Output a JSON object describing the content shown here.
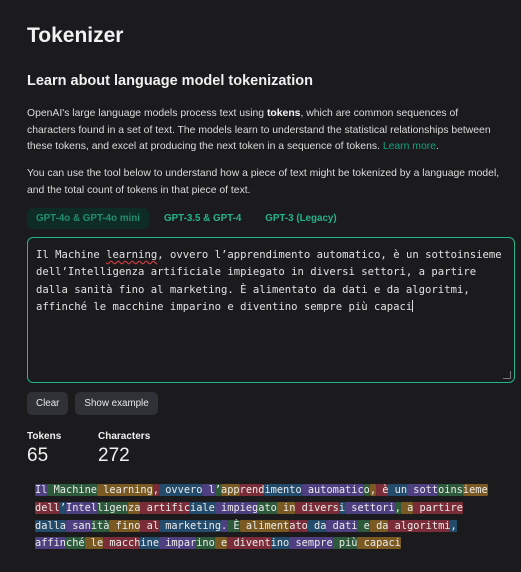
{
  "page": {
    "title": "Tokenizer",
    "subtitle": "Learn about language model tokenization"
  },
  "intro": {
    "p1_before": "OpenAI's large language models process text using ",
    "p1_bold": "tokens",
    "p1_after": ", which are common sequences of characters found in a set of text. The models learn to understand the statistical relationships between these tokens, and excel at producing the next token in a sequence of tokens. ",
    "learn_more": "Learn more",
    "p1_end": ".",
    "p2": "You can use the tool below to understand how a piece of text might be tokenized by a language model, and the total count of tokens in that piece of text."
  },
  "tabs": [
    {
      "label": "GPT-4o & GPT-4o mini",
      "active": true
    },
    {
      "label": "GPT-3.5 & GPT-4",
      "active": false
    },
    {
      "label": "GPT-3 (Legacy)",
      "active": false
    }
  ],
  "input": {
    "l1_a": "Il Machine ",
    "l1_b": "learning",
    "l1_c": ", ovvero l’apprendimento automatico, è un sottoinsieme",
    "l2": "dell’Intelligenza artificiale impiegato in diversi settori, a partire",
    "l3": "dalla sanità fino al marketing. È alimentato da dati e da algoritmi,",
    "l4": "affinché le macchine imparino e diventino sempre più capaci"
  },
  "buttons": {
    "clear": "Clear",
    "show_example": "Show example"
  },
  "stats": {
    "tokens_label": "Tokens",
    "tokens_value": "65",
    "characters_label": "Characters",
    "characters_value": "272"
  },
  "tokenized_lines": [
    [
      "Il",
      " Machine",
      " learning",
      ",",
      " ovvero",
      " l",
      "’",
      "app",
      "rend",
      "imento",
      " automatic",
      "o",
      ",",
      " è",
      " un",
      " sott",
      "oins",
      "ieme"
    ],
    [
      "dell",
      "’",
      "Intel",
      "ligen",
      "za",
      " artific",
      "iale",
      " impieg",
      "ato",
      " in",
      " divers",
      "i",
      " settori",
      ",",
      " a",
      " partire"
    ],
    [
      "dalla",
      " san",
      "ità",
      " fino",
      " al",
      " marketing",
      ".",
      " È",
      " aliment",
      "ato",
      " da",
      " dati",
      " e",
      " da",
      " algoritmi",
      ","
    ],
    [
      "affin",
      "ché",
      " le",
      " macch",
      "ine",
      " impar",
      "ino",
      " e",
      " divent",
      "ino",
      " sempre",
      " più",
      " capaci"
    ]
  ],
  "colors": {
    "background": "#1b1b1e",
    "accent": "#10a37f",
    "token_palette": [
      "#4d3f80",
      "#2d5a3a",
      "#7a5a22",
      "#7a2d38",
      "#234b6b"
    ]
  }
}
